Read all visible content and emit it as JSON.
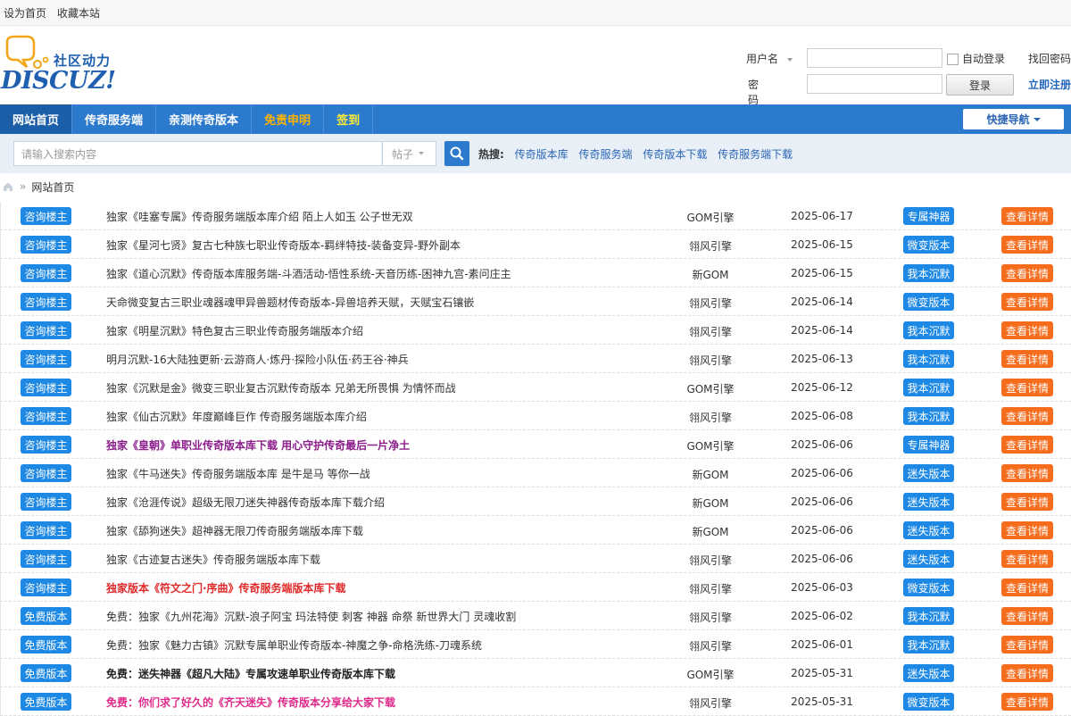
{
  "topbar": {
    "set_home": "设为首页",
    "bookmark": "收藏本站"
  },
  "logo": {
    "cn_text": "社区动力",
    "en_text": "DISCUZ!"
  },
  "login": {
    "username_label": "用户名",
    "password_label": "密码",
    "auto_login": "自动登录",
    "forgot": "找回密码",
    "login_button": "登录",
    "register": "立即注册"
  },
  "nav": {
    "items": [
      "网站首页",
      "传奇服务端",
      "亲测传奇版本",
      "免责申明",
      "签到"
    ],
    "quick": "快捷导航"
  },
  "search": {
    "placeholder": "请输入搜索内容",
    "type": "帖子",
    "hot_label": "热搜:",
    "hot": [
      "传奇版本库",
      "传奇服务端",
      "传奇版本下载",
      "传奇服务端下载"
    ]
  },
  "breadcrumb": {
    "current": "网站首页"
  },
  "colors": {
    "nav": "#2b7acd",
    "tag": "#1e88e5",
    "detail": "#f56c1d"
  },
  "rows": [
    {
      "tag": "咨询楼主",
      "title": "独家《哇塞专属》传奇服务端版本库介绍 陌上人如玉 公子世无双",
      "style": "",
      "engine": "GOM引擎",
      "date": "2025-06-17",
      "badge": "专属神器",
      "action": "查看详情"
    },
    {
      "tag": "咨询楼主",
      "title": "独家《星河七贤》复古七种族七职业传奇版本-羁绊特技-装备变异-野外副本",
      "style": "",
      "engine": "翎风引擎",
      "date": "2025-06-15",
      "badge": "微变版本",
      "action": "查看详情"
    },
    {
      "tag": "咨询楼主",
      "title": "独家《道心沉默》传奇版本库服务端-斗酒活动-悟性系统-天音历练-困神九宫-素问庄主",
      "style": "",
      "engine": "新GOM",
      "date": "2025-06-15",
      "badge": "我本沉默",
      "action": "查看详情"
    },
    {
      "tag": "咨询楼主",
      "title": "天命微变复古三职业魂器魂甲异兽题材传奇版本-异兽培养天赋，天赋宝石镶嵌",
      "style": "",
      "engine": "翎风引擎",
      "date": "2025-06-14",
      "badge": "微变版本",
      "action": "查看详情"
    },
    {
      "tag": "咨询楼主",
      "title": "独家《明星沉默》特色复古三职业传奇服务端版本介绍",
      "style": "",
      "engine": "翎风引擎",
      "date": "2025-06-14",
      "badge": "我本沉默",
      "action": "查看详情"
    },
    {
      "tag": "咨询楼主",
      "title": "明月沉默-16大陆独更新·云游商人·炼丹·探险小队伍·药王谷·神兵",
      "style": "",
      "engine": "翎风引擎",
      "date": "2025-06-13",
      "badge": "我本沉默",
      "action": "查看详情"
    },
    {
      "tag": "咨询楼主",
      "title": "独家《沉默是金》微变三职业复古沉默传奇版本 兄弟无所畏惧 为情怀而战",
      "style": "",
      "engine": "GOM引擎",
      "date": "2025-06-12",
      "badge": "我本沉默",
      "action": "查看详情"
    },
    {
      "tag": "咨询楼主",
      "title": "独家《仙古沉默》年度巅峰巨作 传奇服务端版本库介绍",
      "style": "",
      "engine": "翎风引擎",
      "date": "2025-06-08",
      "badge": "我本沉默",
      "action": "查看详情"
    },
    {
      "tag": "咨询楼主",
      "title": "独家《皇朝》单职业传奇版本库下载 用心守护传奇最后一片净土",
      "style": "purple",
      "engine": "GOM引擎",
      "date": "2025-06-06",
      "badge": "专属神器",
      "action": "查看详情"
    },
    {
      "tag": "咨询楼主",
      "title": "独家《牛马迷失》传奇服务端版本库 是牛是马 等你一战",
      "style": "",
      "engine": "新GOM",
      "date": "2025-06-06",
      "badge": "迷失版本",
      "action": "查看详情"
    },
    {
      "tag": "咨询楼主",
      "title": "独家《沧涯传说》超级无限刀迷失神器传奇版本库下载介绍",
      "style": "",
      "engine": "新GOM",
      "date": "2025-06-06",
      "badge": "迷失版本",
      "action": "查看详情"
    },
    {
      "tag": "咨询楼主",
      "title": "独家《舔狗迷失》超神器无限刀传奇服务端版本库下载",
      "style": "",
      "engine": "新GOM",
      "date": "2025-06-06",
      "badge": "迷失版本",
      "action": "查看详情"
    },
    {
      "tag": "咨询楼主",
      "title": "独家《古迹复古迷失》传奇服务端版本库下载",
      "style": "",
      "engine": "翎风引擎",
      "date": "2025-06-06",
      "badge": "迷失版本",
      "action": "查看详情"
    },
    {
      "tag": "咨询楼主",
      "title": "独家版本《符文之门·序曲》传奇服务端版本库下载",
      "style": "red",
      "engine": "翎风引擎",
      "date": "2025-06-03",
      "badge": "微变版本",
      "action": "查看详情"
    },
    {
      "tag": "免费版本",
      "title": "免费：独家《九州花海》沉默-浪子阿宝 玛法特使 刺客 神器 命祭 新世界大门 灵魂收割",
      "style": "",
      "engine": "翎风引擎",
      "date": "2025-06-02",
      "badge": "我本沉默",
      "action": "查看详情"
    },
    {
      "tag": "免费版本",
      "title": "免费：独家《魅力古镇》沉默专属单职业传奇版本-神魔之争-命格洗练-刀魂系统",
      "style": "",
      "engine": "翎风引擎",
      "date": "2025-06-01",
      "badge": "我本沉默",
      "action": "查看详情"
    },
    {
      "tag": "免费版本",
      "title": "免费：迷失神器《超凡大陆》专属攻速单职业传奇版本库下载",
      "style": "bold",
      "engine": "GOM引擎",
      "date": "2025-05-31",
      "badge": "迷失版本",
      "action": "查看详情"
    },
    {
      "tag": "免费版本",
      "title": "免费：你们求了好久的《齐天迷失》传奇版本分享给大家下载",
      "style": "pink",
      "engine": "翎风引擎",
      "date": "2025-05-31",
      "badge": "微变版本",
      "action": "查看详情"
    }
  ]
}
